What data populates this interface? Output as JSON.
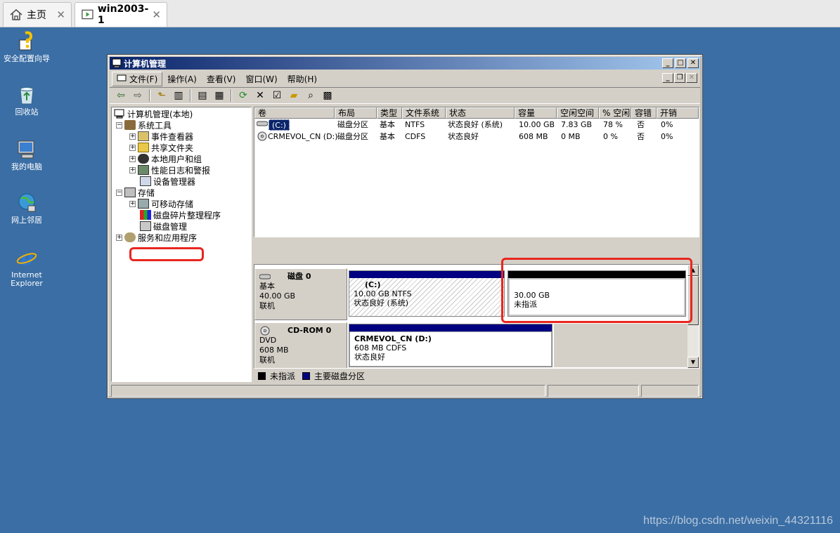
{
  "vm_tabs": [
    {
      "label": "主页",
      "icon": "home-icon"
    },
    {
      "label": "win2003-1",
      "icon": "vm-icon"
    }
  ],
  "desktop_icons": [
    {
      "label": "安全配置向导",
      "icon": "security-wizard-icon"
    },
    {
      "label": "回收站",
      "icon": "recycle-bin-icon"
    },
    {
      "label": "我的电脑",
      "icon": "my-computer-icon"
    },
    {
      "label": "网上邻居",
      "icon": "network-places-icon"
    },
    {
      "label": "Internet Explorer",
      "icon": "internet-explorer-icon"
    }
  ],
  "watermark": "https://blog.csdn.net/weixin_44321116",
  "window": {
    "title": "计算机管理",
    "menu": [
      "文件(F)",
      "操作(A)",
      "查看(V)",
      "窗口(W)",
      "帮助(H)"
    ]
  },
  "tree": {
    "root": "计算机管理(本地)",
    "items": [
      {
        "label": "系统工具",
        "expander": "−"
      },
      {
        "label": "事件查看器",
        "expander": "+"
      },
      {
        "label": "共享文件夹",
        "expander": "+"
      },
      {
        "label": "本地用户和组",
        "expander": "+"
      },
      {
        "label": "性能日志和警报",
        "expander": "+"
      },
      {
        "label": "设备管理器",
        "expander": ""
      },
      {
        "label": "存储",
        "expander": "−"
      },
      {
        "label": "可移动存储",
        "expander": "+"
      },
      {
        "label": "磁盘碎片整理程序",
        "expander": ""
      },
      {
        "label": "磁盘管理",
        "expander": ""
      },
      {
        "label": "服务和应用程序",
        "expander": "+"
      }
    ]
  },
  "volume_list": {
    "headers": [
      "卷",
      "布局",
      "类型",
      "文件系统",
      "状态",
      "容量",
      "空闲空间",
      "% 空闲",
      "容错",
      "开销"
    ],
    "rows": [
      [
        "(C:)",
        "磁盘分区",
        "基本",
        "NTFS",
        "状态良好 (系统)",
        "10.00 GB",
        "7.83 GB",
        "78 %",
        "否",
        "0%"
      ],
      [
        "CRMEVOL_CN (D:)",
        "磁盘分区",
        "基本",
        "CDFS",
        "状态良好",
        "608 MB",
        "0 MB",
        "0 %",
        "否",
        "0%"
      ]
    ]
  },
  "disks": [
    {
      "name": "磁盘 0",
      "type": "基本",
      "size": "40.00 GB",
      "status": "联机",
      "partitions": [
        {
          "name": "(C:)",
          "info": "10.00 GB NTFS",
          "status": "状态良好 (系统)"
        },
        {
          "name": "",
          "info": "30.00 GB",
          "status": "未指派"
        }
      ]
    },
    {
      "name": "CD-ROM 0",
      "type": "DVD",
      "size": "608 MB",
      "status": "联机",
      "partitions": [
        {
          "name": "CRMEVOL_CN (D:)",
          "info": "608 MB CDFS",
          "status": "状态良好"
        }
      ]
    }
  ],
  "legend": [
    {
      "label": "未指派",
      "color": "#000000"
    },
    {
      "label": "主要磁盘分区",
      "color": "#000080"
    }
  ],
  "colors": {
    "desktop": "#3a6ea5",
    "highlight": "#e8261f",
    "primary_partition": "#000080",
    "unallocated": "#000000"
  }
}
